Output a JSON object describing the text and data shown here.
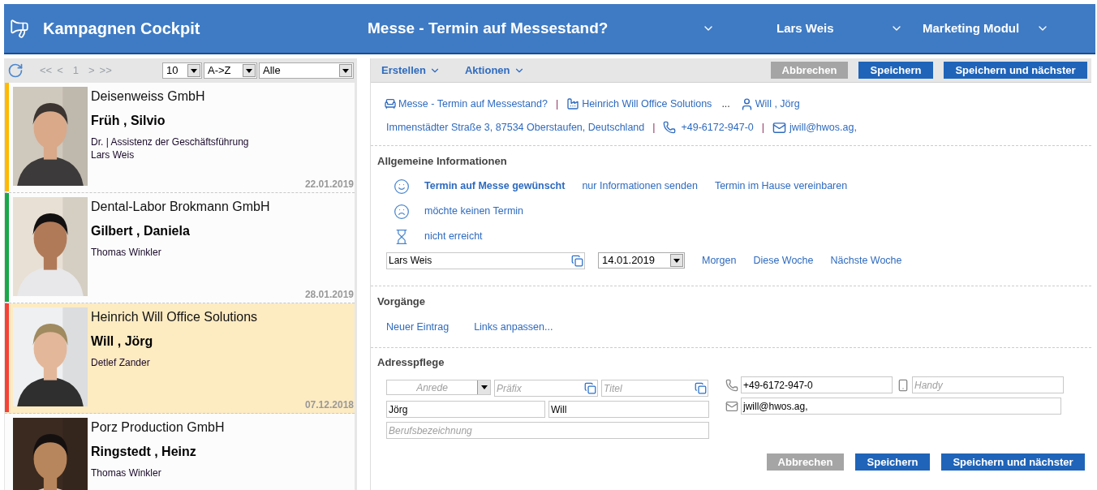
{
  "header": {
    "title": "Kampagnen Cockpit",
    "campaign": "Messe - Termin auf Messestand?",
    "user": "Lars Weis",
    "module": "Marketing Modul"
  },
  "list_toolbar": {
    "pager": {
      "first": "<<",
      "prev": "<",
      "page": "1",
      "next": ">",
      "last": ">>"
    },
    "page_size": "10",
    "sort": "A->Z",
    "filter": "Alle"
  },
  "cards": [
    {
      "company": "Deisenweiss GmbH",
      "name": "Früh , Silvio",
      "details": [
        "Dr. | Assistenz der Geschäftsführung",
        "Lars Weis"
      ],
      "date": "22.01.2019",
      "color": "#ffb900",
      "selected": false
    },
    {
      "company": "Dental-Labor Brokmann GmbH",
      "name": "Gilbert , Daniela",
      "details": [
        "Thomas Winkler"
      ],
      "date": "28.01.2019",
      "color": "#1aa84a",
      "selected": false
    },
    {
      "company": "Heinrich Will Office Solutions",
      "name": "Will , Jörg",
      "details": [
        "Detlef Zander"
      ],
      "date": "07.12.2018",
      "color": "#f44336",
      "selected": true
    },
    {
      "company": "Porz Production GmbH",
      "name": "Ringstedt , Heinz",
      "details": [
        "Thomas Winkler"
      ],
      "selected": false
    }
  ],
  "action_bar": {
    "menus": [
      "Erstellen",
      "Aktionen"
    ],
    "buttons": [
      {
        "label": "Abbrechen",
        "kind": "secondary"
      },
      {
        "label": "Speichern",
        "kind": "primary"
      },
      {
        "label": "Speichern und nächster",
        "kind": "primary"
      }
    ]
  },
  "context": {
    "campaign": "Messe - Termin auf Messestand?",
    "company": "Heinrich Will Office Solutions",
    "more": "...",
    "separators": [
      "|",
      "|",
      "|"
    ],
    "contact": "Will , Jörg",
    "address": "Immenstädter Straße 3, 87534 Oberstaufen, Deutschland",
    "phone": "+49-6172-947-0",
    "email": "jwill@hwos.ag,"
  },
  "general": {
    "title": "Allgemeine Informationen",
    "outcomes": [
      {
        "kind": "positive",
        "options": [
          {
            "label": "Termin auf Messe gewünscht",
            "selected": true
          },
          {
            "label": "nur Informationen senden",
            "selected": false
          },
          {
            "label": "Termin im Hause vereinbaren",
            "selected": false
          }
        ]
      },
      {
        "kind": "negative",
        "options": [
          {
            "label": "möchte keinen Termin",
            "selected": false
          }
        ]
      },
      {
        "kind": "pending",
        "options": [
          {
            "label": "nicht erreicht",
            "selected": false
          }
        ]
      }
    ],
    "assignee": "Lars Weis",
    "date": "14.01.2019",
    "quick_dates": [
      "Morgen",
      "Diese Woche",
      "Nächste Woche"
    ]
  },
  "processes": {
    "title": "Vorgänge",
    "links": [
      "Neuer Eintrag",
      "Links anpassen..."
    ]
  },
  "address": {
    "title": "Adresspflege",
    "salutation": {
      "placeholder": "Anrede"
    },
    "prefix": {
      "placeholder": "Präfix"
    },
    "academic_title": {
      "placeholder": "Titel"
    },
    "first_name": "Jörg",
    "last_name": "Will",
    "job_title": {
      "placeholder": "Berufsbezeichnung"
    },
    "phone": "+49-6172-947-0",
    "mobile": {
      "placeholder": "Handy"
    },
    "email": "jwill@hwos.ag,"
  },
  "footer_buttons": [
    {
      "label": "Abbrechen",
      "kind": "secondary"
    },
    {
      "label": "Speichern",
      "kind": "primary"
    },
    {
      "label": "Speichern und nächster",
      "kind": "primary"
    }
  ]
}
